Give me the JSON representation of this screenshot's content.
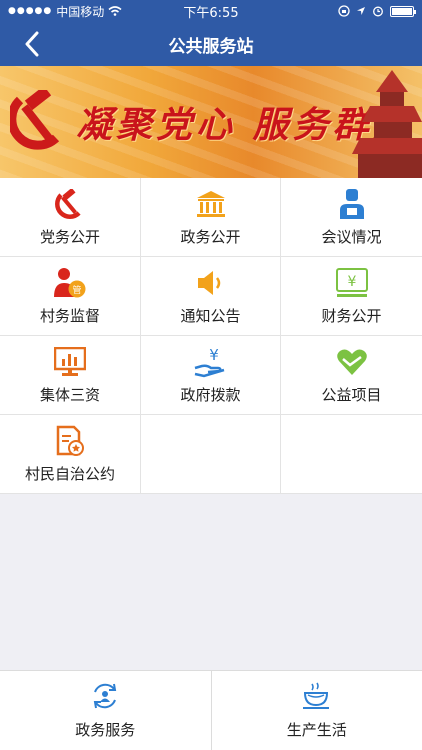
{
  "status_bar": {
    "carrier": "中国移动",
    "time": "下午6:55"
  },
  "nav": {
    "title": "公共服务站"
  },
  "banner": {
    "slogan": "凝聚党心  服务群众"
  },
  "colors": {
    "header": "#2f5aa6",
    "party_red": "#d9261c",
    "icon_orange": "#f2a21b",
    "icon_blue": "#2d7fd2",
    "icon_green": "#7cc242"
  },
  "services": [
    {
      "label": "党务公开",
      "icon": "hammer-sickle-icon"
    },
    {
      "label": "政务公开",
      "icon": "government-building-icon"
    },
    {
      "label": "会议情况",
      "icon": "meeting-person-icon"
    },
    {
      "label": "村务监督",
      "icon": "supervision-person-icon"
    },
    {
      "label": "通知公告",
      "icon": "speaker-icon"
    },
    {
      "label": "财务公开",
      "icon": "finance-yuan-icon"
    },
    {
      "label": "集体三资",
      "icon": "chart-monitor-icon"
    },
    {
      "label": "政府拨款",
      "icon": "money-hand-icon"
    },
    {
      "label": "公益项目",
      "icon": "heart-icon"
    },
    {
      "label": "村民自治公约",
      "icon": "document-seal-icon"
    }
  ],
  "tabs": [
    {
      "label": "政务服务",
      "icon": "refresh-person-icon"
    },
    {
      "label": "生产生活",
      "icon": "coffee-cup-icon"
    }
  ]
}
